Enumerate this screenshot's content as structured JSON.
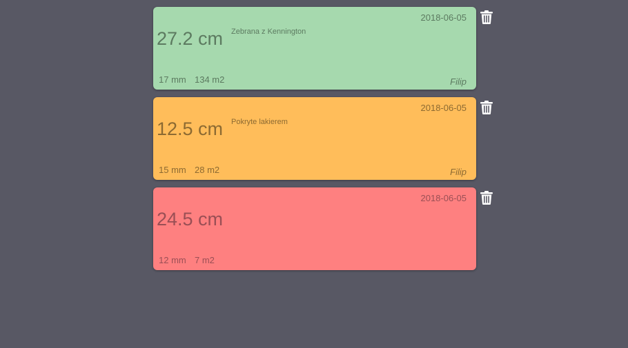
{
  "colors": {
    "background": "#585864",
    "green": "#a6d9ae",
    "orange": "#ffbd5a",
    "red": "#fe8080"
  },
  "cards": [
    {
      "color": "#a6d9ae",
      "text_color": "#5c7a60",
      "date": "2018-06-05",
      "size": "27.2 cm",
      "note": "Zebrana z Kennington",
      "thickness": "17 mm",
      "area": "134 m2",
      "author": "Filip",
      "action_icon": "trash-icon"
    },
    {
      "color": "#ffbd5a",
      "text_color": "#8c6a32",
      "date": "2018-06-05",
      "size": "12.5 cm",
      "note": "Pokryte lakierem",
      "thickness": "15 mm",
      "area": "28 m2",
      "author": "Filip",
      "action_icon": "trash-icon"
    },
    {
      "color": "#fe8080",
      "text_color": "#9a4f55",
      "date": "2018-06-05",
      "size": "24.5 cm",
      "note": "",
      "thickness": "12 mm",
      "area": "7 m2",
      "author": "",
      "action_icon": "trash-icon"
    }
  ]
}
